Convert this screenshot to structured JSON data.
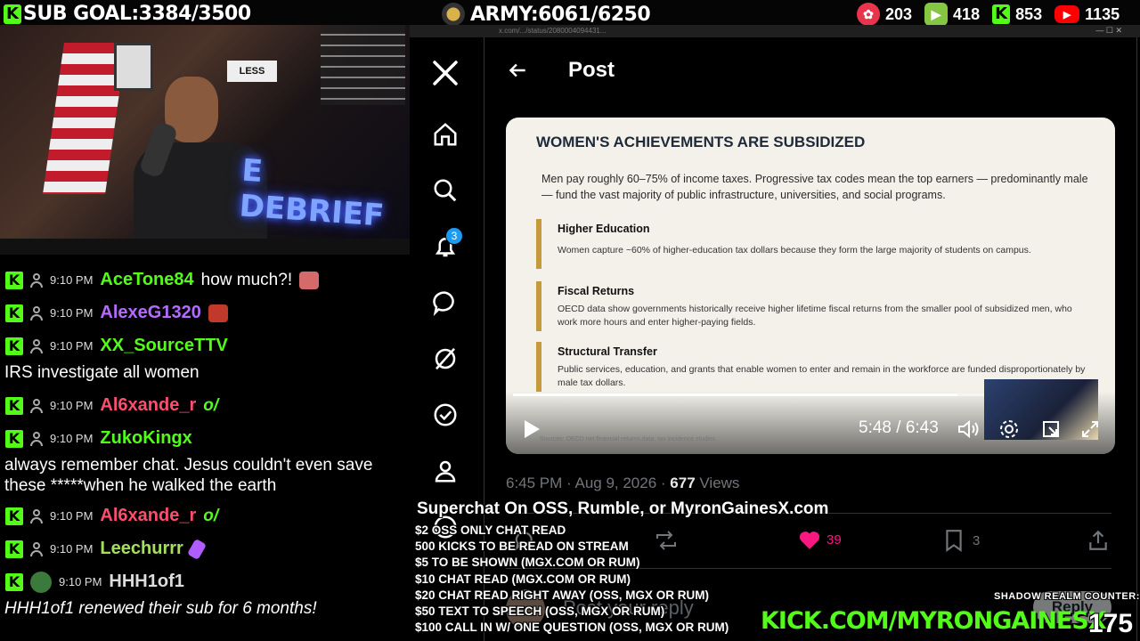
{
  "top": {
    "sub_goal": "SUB GOAL:3384/3500",
    "army": "ARMY:6061/6250",
    "stats": [
      {
        "icon": "rumble-icon",
        "value": "203",
        "color": "#e8344c"
      },
      {
        "icon": "rumble-play-icon",
        "value": "418",
        "color": "#85c742"
      },
      {
        "icon": "kick-icon",
        "value": "853",
        "color": "#53fc18"
      },
      {
        "icon": "youtube-icon",
        "value": "1135",
        "color": "#ff0000"
      }
    ]
  },
  "cam": {
    "neon": "E DEBRIEF",
    "sign": "LESS"
  },
  "chat": [
    {
      "time": "9:10 PM",
      "name": "AceTone84",
      "color": "#53fc18",
      "msg": "how much?!",
      "emote": "#d46a6a"
    },
    {
      "time": "9:10 PM",
      "name": "AlexeG1320",
      "color": "#b56bff",
      "msg": "",
      "emote": "#c0392b"
    },
    {
      "time": "9:10 PM",
      "name": "XX_SourceTTV",
      "color": "#53fc18",
      "msg": "",
      "emote": ""
    },
    {
      "text": "IRS investigate all women"
    },
    {
      "time": "9:10 PM",
      "name": "Al6xande_r",
      "color": "#ff4d6d",
      "msg": "o/",
      "emote": ""
    },
    {
      "time": "9:10 PM",
      "name": "ZukoKingx",
      "color": "#53fc18",
      "msg": "",
      "emote": ""
    },
    {
      "text": "always remember chat. Jesus couldn't even save these *****when he walked the earth"
    },
    {
      "time": "9:10 PM",
      "name": "Al6xande_r",
      "color": "#ff4d6d",
      "msg": "o/",
      "emote": ""
    },
    {
      "time": "9:10 PM",
      "name": "Leechurrr",
      "color": "#a4e05b",
      "msg": "",
      "emote": "#b05cff"
    },
    {
      "time": "9:10 PM",
      "name": "HHH1of1",
      "color": "#dddddd",
      "msg": "",
      "emote": ""
    },
    {
      "text": "HHH1of1 renewed their sub for 6 months!"
    }
  ],
  "x": {
    "header_title": "Post",
    "notif_count": "3",
    "url": "x.com/.../status/2080004094431..."
  },
  "slide": {
    "title": "WOMEN'S ACHIEVEMENTS ARE SUBSIDIZED",
    "intro": "Men pay roughly 60–75% of income taxes. Progressive tax codes mean the top earners — predominantly male — fund the vast majority of public infrastructure, universities, and social programs.",
    "sections": [
      {
        "heading": "Higher Education",
        "text": "Women capture ~60% of higher-education tax dollars because they form the large majority of students on campus."
      },
      {
        "heading": "Fiscal Returns",
        "text": "OECD data show governments historically receive higher lifetime fiscal returns from the smaller pool of subsidized men, who work more hours and enter higher-paying fields."
      },
      {
        "heading": "Structural Transfer",
        "text": "Public services, education, and grants that enable women to enter and remain in the workforce are funded disproportionately by male tax dollars."
      }
    ],
    "source": "Sources: OECD net financial returns data; tax incidence studies"
  },
  "video": {
    "time": "5:48 / 6:43",
    "progress": 0.86
  },
  "post": {
    "time": "6:45 PM · Aug 9, 2026 · ",
    "views": "677",
    "views_label": " Views",
    "likes": "39",
    "bookmarks": "3",
    "reply_placeholder": "Post your reply",
    "reply_button": "Reply"
  },
  "overlay": {
    "headline": "Superchat On OSS, Rumble, or MyronGainesX.com",
    "lines": [
      "$2 OSS ONLY CHAT READ",
      "500 KICKS TO BE READ ON STREAM",
      "$5 TO BE SHOWN (MGX.COM OR RUM)",
      "$10 CHAT READ (MGX.COM OR RUM)",
      "$20 CHAT READ RIGHT AWAY (OSS, MGX OR RUM)",
      "$50 TEXT TO SPEECH (OSS, MGX OR RUM)",
      "$100 CALL IN W/ ONE QUESTION (OSS, MGX OR RUM)"
    ],
    "kick_url": "KICK.COM/MYRONGAINESX",
    "shadow_label": "SHADOW REALM COUNTER:",
    "shadow_value": "175"
  }
}
